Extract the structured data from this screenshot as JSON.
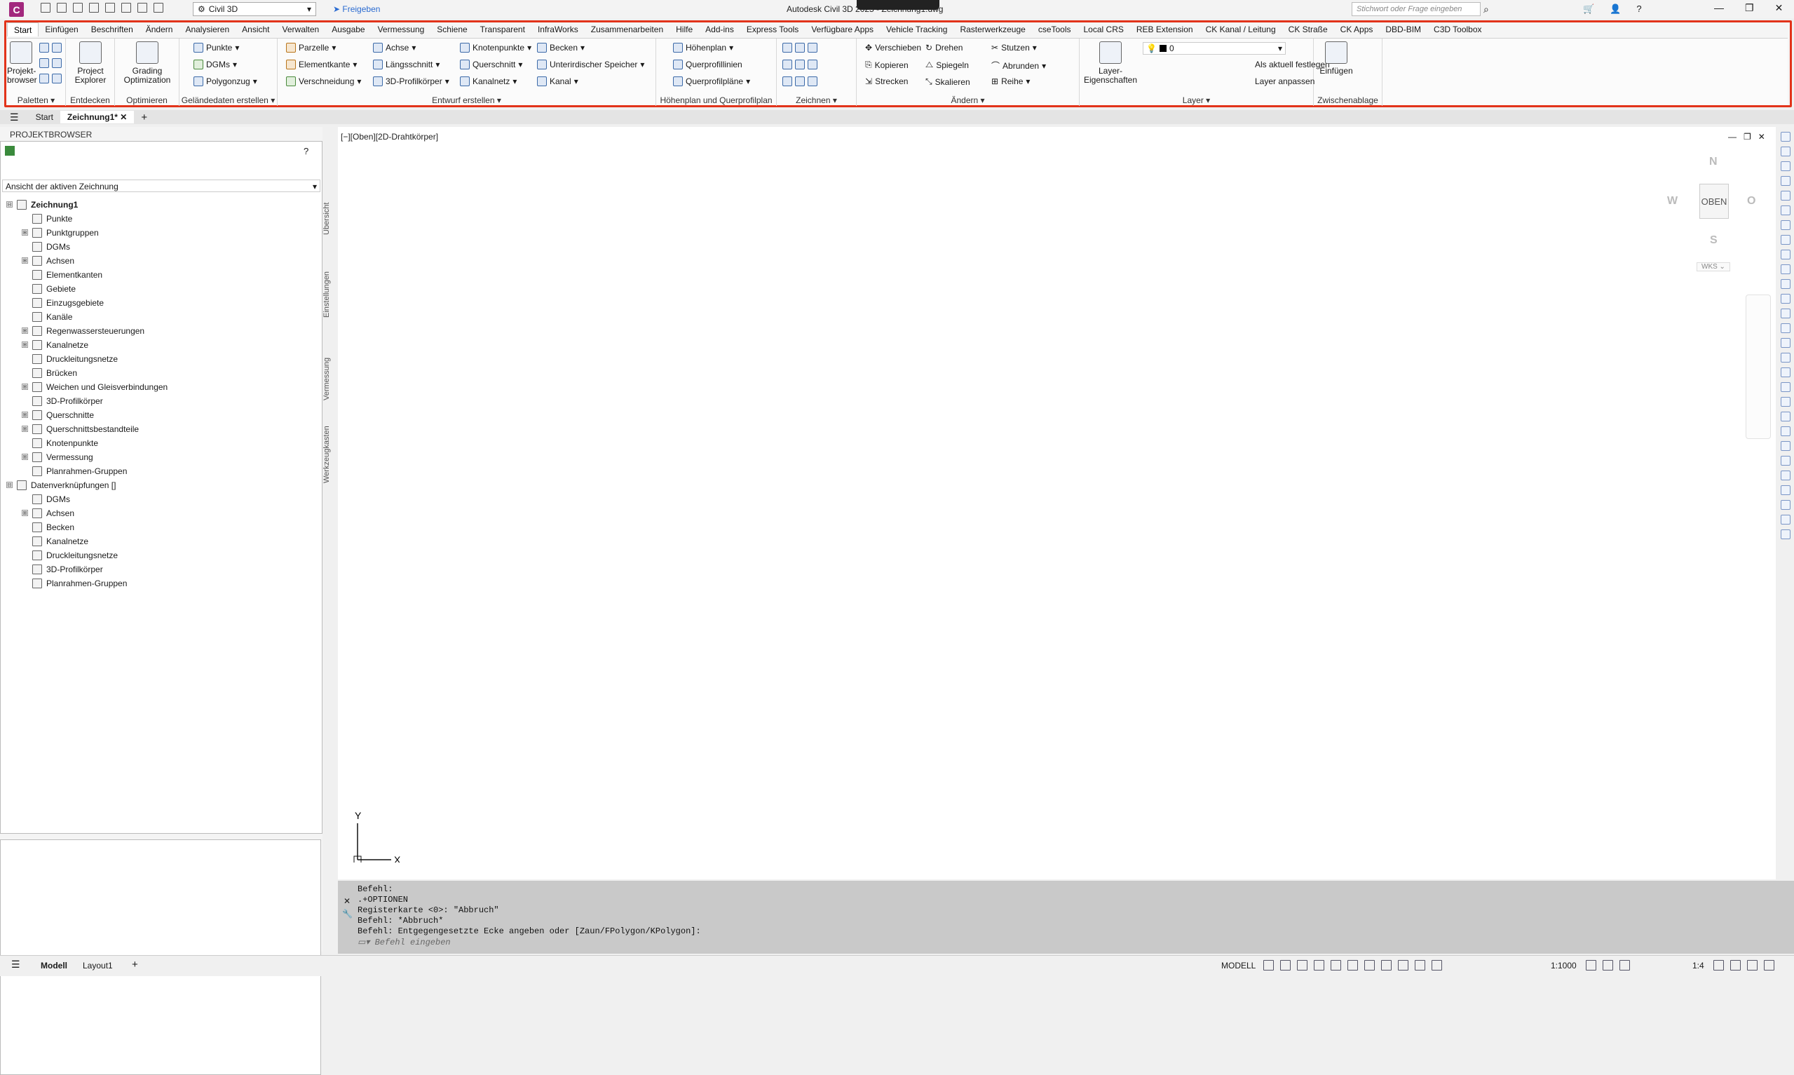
{
  "app": {
    "logo": "C",
    "workspace": "Civil 3D",
    "share": "Freigeben",
    "title": "Autodesk Civil 3D 2025 - Zeichnung1.dwg",
    "search_placeholder": "Stichwort oder Frage eingeben"
  },
  "ribbon": {
    "tabs": [
      "Start",
      "Einfügen",
      "Beschriften",
      "Ändern",
      "Analysieren",
      "Ansicht",
      "Verwalten",
      "Ausgabe",
      "Vermessung",
      "Schiene",
      "Transparent",
      "InfraWorks",
      "Zusammenarbeiten",
      "Hilfe",
      "Add-ins",
      "Express Tools",
      "Verfügbare Apps",
      "Vehicle Tracking",
      "Rasterwerkzeuge",
      "cseTools",
      "Local CRS",
      "REB Extension",
      "CK Kanal / Leitung",
      "CK Straße",
      "CK Apps",
      "DBD-BIM",
      "C3D Toolbox"
    ],
    "active_tab": "Start",
    "panels": {
      "paletten": {
        "title": "Paletten",
        "big": "Projekt-\nbrowser"
      },
      "entdecken": {
        "title": "Entdecken",
        "big": "Project\nExplorer"
      },
      "optimieren": {
        "title": "Optimieren",
        "big": "Grading\nOptimization"
      },
      "gelaende": {
        "title": "Geländedaten erstellen",
        "items": [
          "Punkte",
          "DGMs",
          "Polygonzug"
        ]
      },
      "entwurf": {
        "title": "Entwurf erstellen",
        "items": [
          "Parzelle",
          "Elementkante",
          "Verschneidung",
          "Achse",
          "Längsschnitt",
          "3D-Profilkörper",
          "Knotenpunkte",
          "Querschnitt",
          "Kanalnetz",
          "Becken",
          "Unterirdischer Speicher",
          "Kanal"
        ]
      },
      "hoehenplan": {
        "title": "Höhenplan und Querprofilplan",
        "items": [
          "Höhenplan",
          "Querprofillinien",
          "Querprofilpläne"
        ]
      },
      "zeichnen": {
        "title": "Zeichnen"
      },
      "aendern": {
        "title": "Ändern",
        "items": [
          "Verschieben",
          "Drehen",
          "Stutzen",
          "Kopieren",
          "Spiegeln",
          "Abrunden",
          "Strecken",
          "Skalieren",
          "Reihe"
        ]
      },
      "layer": {
        "title": "Layer",
        "big": "Layer-\nEigenschaften",
        "current_layer": "0",
        "items": [
          "Als aktuell festlegen",
          "Layer anpassen"
        ]
      },
      "zwischenablage": {
        "title": "Zwischenablage",
        "big": "Einfügen"
      }
    }
  },
  "doc_tabs": [
    "Start",
    "Zeichnung1*"
  ],
  "project_browser": {
    "title": "PROJEKTBROWSER",
    "view_select": "Ansicht der aktiven Zeichnung",
    "vtabs": [
      "Übersicht",
      "Einstellungen",
      "Vermessung",
      "Werkzeugkasten"
    ],
    "tree": [
      {
        "label": "Zeichnung1",
        "level": 0,
        "exp": "⊟",
        "bold": true
      },
      {
        "label": "Punkte",
        "level": 1,
        "exp": ""
      },
      {
        "label": "Punktgruppen",
        "level": 1,
        "exp": "⊞"
      },
      {
        "label": "DGMs",
        "level": 1,
        "exp": ""
      },
      {
        "label": "Achsen",
        "level": 1,
        "exp": "⊞"
      },
      {
        "label": "Elementkanten",
        "level": 1,
        "exp": ""
      },
      {
        "label": "Gebiete",
        "level": 1,
        "exp": ""
      },
      {
        "label": "Einzugsgebiete",
        "level": 1,
        "exp": ""
      },
      {
        "label": "Kanäle",
        "level": 1,
        "exp": ""
      },
      {
        "label": "Regenwassersteuerungen",
        "level": 1,
        "exp": "⊞"
      },
      {
        "label": "Kanalnetze",
        "level": 1,
        "exp": "⊞"
      },
      {
        "label": "Druckleitungsnetze",
        "level": 1,
        "exp": ""
      },
      {
        "label": "Brücken",
        "level": 1,
        "exp": ""
      },
      {
        "label": "Weichen und Gleisverbindungen",
        "level": 1,
        "exp": "⊞"
      },
      {
        "label": "3D-Profilkörper",
        "level": 1,
        "exp": ""
      },
      {
        "label": "Querschnitte",
        "level": 1,
        "exp": "⊞"
      },
      {
        "label": "Querschnittsbestandteile",
        "level": 1,
        "exp": "⊞"
      },
      {
        "label": "Knotenpunkte",
        "level": 1,
        "exp": ""
      },
      {
        "label": "Vermessung",
        "level": 1,
        "exp": "⊞"
      },
      {
        "label": "Planrahmen-Gruppen",
        "level": 1,
        "exp": ""
      },
      {
        "label": "Datenverknüpfungen []",
        "level": 0,
        "exp": "⊟"
      },
      {
        "label": "DGMs",
        "level": 1,
        "exp": ""
      },
      {
        "label": "Achsen",
        "level": 1,
        "exp": "⊞"
      },
      {
        "label": "Becken",
        "level": 1,
        "exp": ""
      },
      {
        "label": "Kanalnetze",
        "level": 1,
        "exp": ""
      },
      {
        "label": "Druckleitungsnetze",
        "level": 1,
        "exp": ""
      },
      {
        "label": "3D-Profilkörper",
        "level": 1,
        "exp": ""
      },
      {
        "label": "Planrahmen-Gruppen",
        "level": 1,
        "exp": ""
      }
    ]
  },
  "viewport": {
    "label": "[−][Oben][2D-Drahtkörper]",
    "compass": {
      "n": "N",
      "s": "S",
      "w": "W",
      "e": "O"
    },
    "viewcube": "OBEN",
    "wcs": "WKS ⌄",
    "ucs_x": "X",
    "ucs_y": "Y"
  },
  "command": {
    "history": "Befehl:\n.+OPTIONEN\nRegisterkarte <0>: \"Abbruch\"\nBefehl: *Abbruch*\nBefehl: Entgegengesetzte Ecke angeben oder [Zaun/FPolygon/KPolygon]:",
    "placeholder": "Befehl eingeben"
  },
  "status": {
    "tabs": [
      "Modell",
      "Layout1"
    ],
    "mode": "MODELL",
    "scale": "1:1000",
    "annoscale": "1:4"
  }
}
